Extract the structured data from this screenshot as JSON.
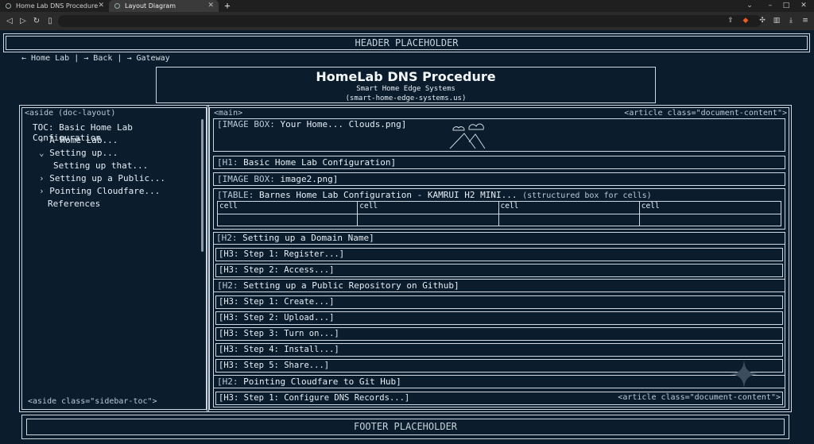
{
  "browser": {
    "tabs": [
      {
        "title": "Home Lab DNS Procedure"
      },
      {
        "title": "Layout Diagram"
      }
    ],
    "new_tab": "+",
    "window_controls": {
      "minimize": "–",
      "maximize": "□",
      "close": "✕",
      "tabs_menu": "⌄"
    }
  },
  "header": {
    "label": "HEADER PLACEHOLDER"
  },
  "breadcrumb": "← Home Lab | → Back | → Gateway",
  "title_block": {
    "title": "HomeLab DNS Procedure",
    "subtitle": "Smart Home Edge Systems",
    "domain": "(smart-home-edge-systems.us)"
  },
  "aside": {
    "label": "<aside (doc-layout)",
    "toc_title": "TOC: Basic Home Lab Configuration",
    "items": [
      {
        "marker": "›",
        "label": "A Home Lab..."
      },
      {
        "marker": "⌄",
        "label": "Setting up..."
      },
      {
        "marker": "",
        "label": "Setting up that..."
      },
      {
        "marker": "›",
        "label": "Setting up a Public..."
      },
      {
        "marker": "›",
        "label": "Pointing Cloudfare..."
      },
      {
        "marker": "",
        "label": "References"
      }
    ],
    "bottom_label": "<aside class=\"sidebar-toc\">"
  },
  "main": {
    "label": "<main>",
    "article_label": "<article class=\"document-content\">",
    "image_box_1": {
      "tag": "[IMAGE BOX:",
      "text": " Your Home... Clouds.png]"
    },
    "h1": {
      "tag": "[H1:",
      "text": " Basic Home Lab Configuration]"
    },
    "image_box_2": {
      "tag": "[IMAGE BOX:",
      "text": " image2.png]"
    },
    "table": {
      "tag": "[TABLE:",
      "text": " Barnes Home Lab Configuration - KAMRUI H2 MINI...",
      "note": "(sttructured box for cells)",
      "cells": [
        "cell",
        "cell",
        "cell",
        "cell"
      ]
    },
    "sections": [
      {
        "tag": "[H2:",
        "text": " Setting up a Domain Name]",
        "level": 2
      },
      {
        "tag": "[H3:",
        "text": " Step 1: Register...]",
        "level": 3
      },
      {
        "tag": "[H3:",
        "text": " Step 2: Access...]",
        "level": 3
      },
      {
        "tag": "[H2:",
        "text": " Setting up a Public Repository on Github]",
        "level": 2
      },
      {
        "tag": "[H3:",
        "text": " Step 1: Create...]",
        "level": 3
      },
      {
        "tag": "[H3:",
        "text": " Step 2: Upload...]",
        "level": 3
      },
      {
        "tag": "[H3:",
        "text": " Step 3: Turn on...]",
        "level": 3
      },
      {
        "tag": "[H3:",
        "text": " Step 4: Install...]",
        "level": 3
      },
      {
        "tag": "[H3:",
        "text": " Step 5: Share...]",
        "level": 3
      },
      {
        "tag": "[H2:",
        "text": " Pointing Cloudfare to Git Hub]",
        "level": 2
      },
      {
        "tag": "[H3:",
        "text": " Step 1: Configure DNS Records...]",
        "level": 3
      }
    ],
    "article_end_label": "<article class=\"document-content\">"
  },
  "footer": {
    "label": "FOOTER PLACEHOLDER"
  },
  "colors": {
    "background": "#0b1c2c",
    "border": "#cfd8e0",
    "text": "#e6eef5"
  }
}
